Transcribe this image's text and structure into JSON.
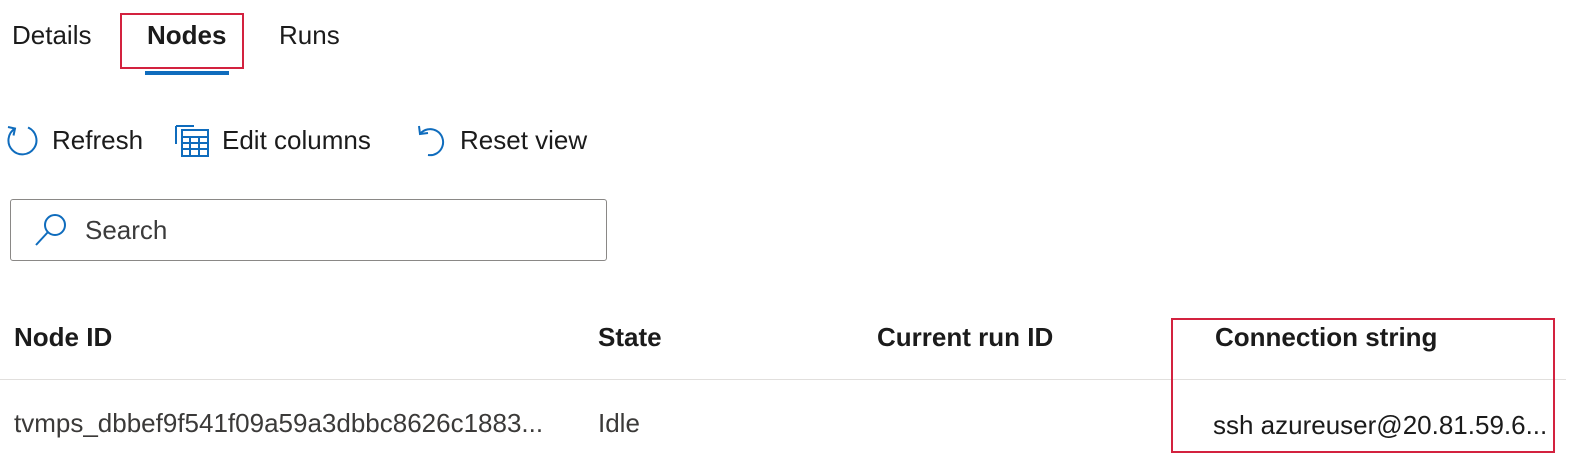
{
  "tabs": [
    {
      "label": "Details"
    },
    {
      "label": "Nodes"
    },
    {
      "label": "Runs"
    }
  ],
  "toolbar": {
    "refresh_label": "Refresh",
    "edit_columns_label": "Edit columns",
    "reset_view_label": "Reset view"
  },
  "search": {
    "placeholder": "Search",
    "value": ""
  },
  "table": {
    "columns": [
      "Node ID",
      "State",
      "Current run ID",
      "Connection string"
    ],
    "rows": [
      {
        "node_id": "tvmps_dbbef9f541f09a59a3dbbc8626c1883...",
        "state": "Idle",
        "current_run_id": "",
        "connection_string": "ssh azureuser@20.81.59.6..."
      }
    ]
  },
  "colors": {
    "accent": "#0f6cbd",
    "highlight": "#d3223f",
    "text": "#1b1b1b"
  },
  "icons": {
    "refresh": "refresh-icon",
    "edit_columns": "table-icon",
    "reset_view": "undo-icon",
    "search": "search-icon"
  }
}
